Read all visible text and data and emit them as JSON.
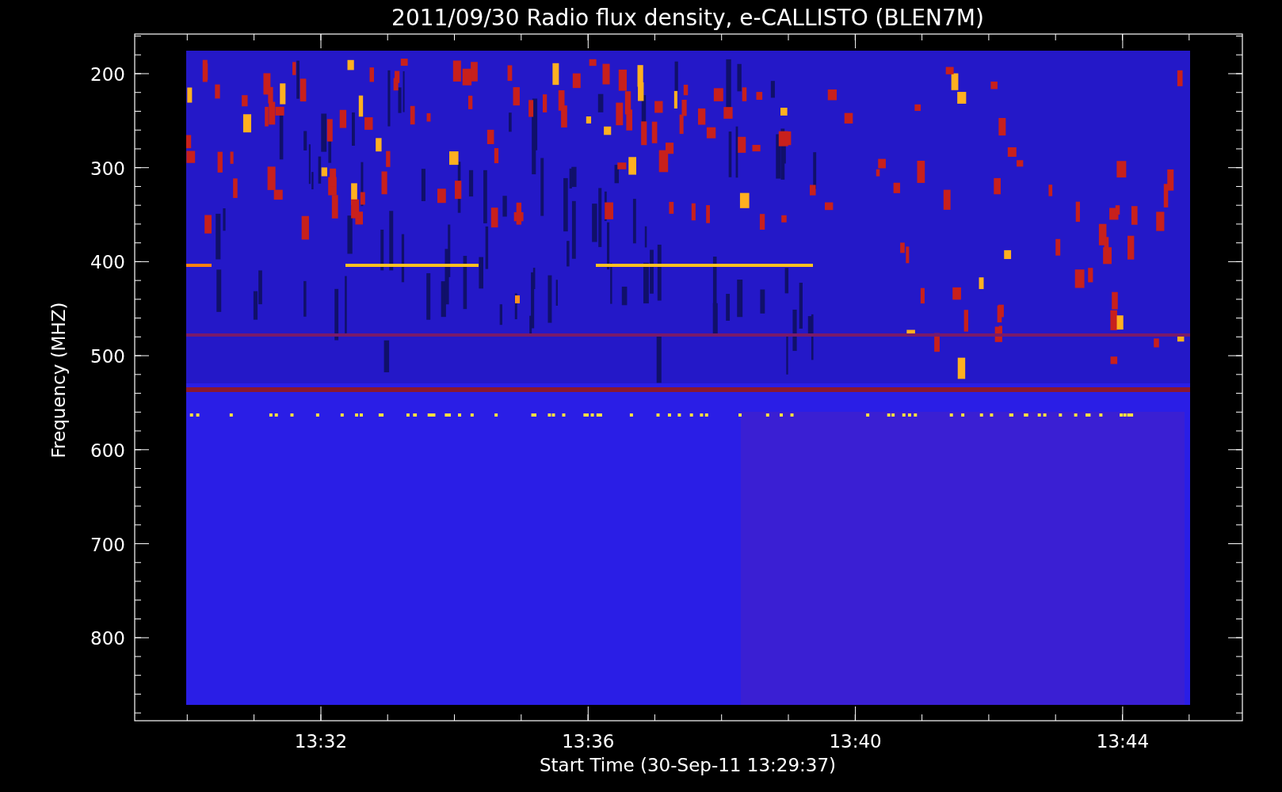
{
  "title": "2011/09/30  Radio flux density, e-CALLISTO (BLEN7M)",
  "y_axis": {
    "label": "Frequency (MHZ)",
    "ticks": [
      "200",
      "300",
      "400",
      "500",
      "600",
      "700",
      "800"
    ]
  },
  "x_axis": {
    "label": "Start Time (30-Sep-11 13:29:37)",
    "ticks": [
      "13:32",
      "13:36",
      "13:40",
      "13:44"
    ]
  }
}
